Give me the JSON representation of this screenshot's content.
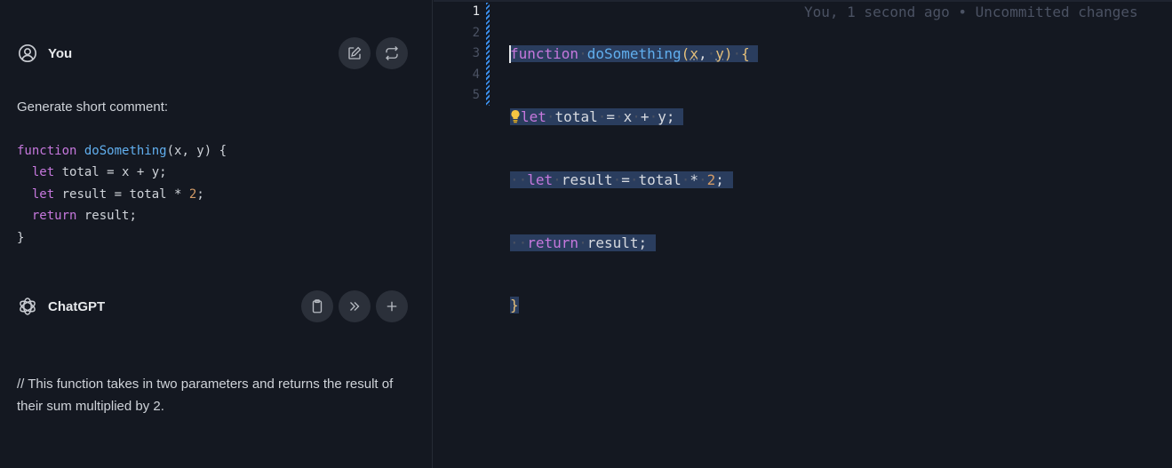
{
  "chat": {
    "user": {
      "name": "You",
      "avatar_icon": "user-circle-icon",
      "actions": [
        {
          "name": "edit-message-button",
          "icon": "pencil-square-icon"
        },
        {
          "name": "regenerate-button",
          "icon": "arrows-repeat-icon"
        }
      ],
      "prompt": "Generate short comment:",
      "code_lines": [
        "function doSomething(x, y) {",
        "  let total = x + y;",
        "  let result = total * 2;",
        "  return result;",
        "}"
      ]
    },
    "assistant": {
      "name": "ChatGPT",
      "avatar_icon": "openai-logo-icon",
      "actions": [
        {
          "name": "copy-button",
          "icon": "clipboard-icon"
        },
        {
          "name": "insert-button",
          "icon": "chevrons-right-icon"
        },
        {
          "name": "new-file-button",
          "icon": "plus-icon"
        }
      ],
      "answer": "// This function takes in two parameters and returns the result of their sum multiplied by 2."
    }
  },
  "editor": {
    "line_numbers": [
      "1",
      "2",
      "3",
      "4",
      "5"
    ],
    "active_line": "1",
    "blame": "You, 1 second ago • Uncommitted changes",
    "lines": [
      "function doSomething(x, y) {",
      "  let total = x + y;",
      "  let result = total * 2;",
      "  return result;",
      "}"
    ]
  },
  "colors": {
    "background": "#141821",
    "button_bg": "#2b303a",
    "keyword": "#c678dd",
    "function": "#61afef",
    "number": "#d19a66",
    "brace": "#e5c07b",
    "selection": "#2a3d5e"
  }
}
